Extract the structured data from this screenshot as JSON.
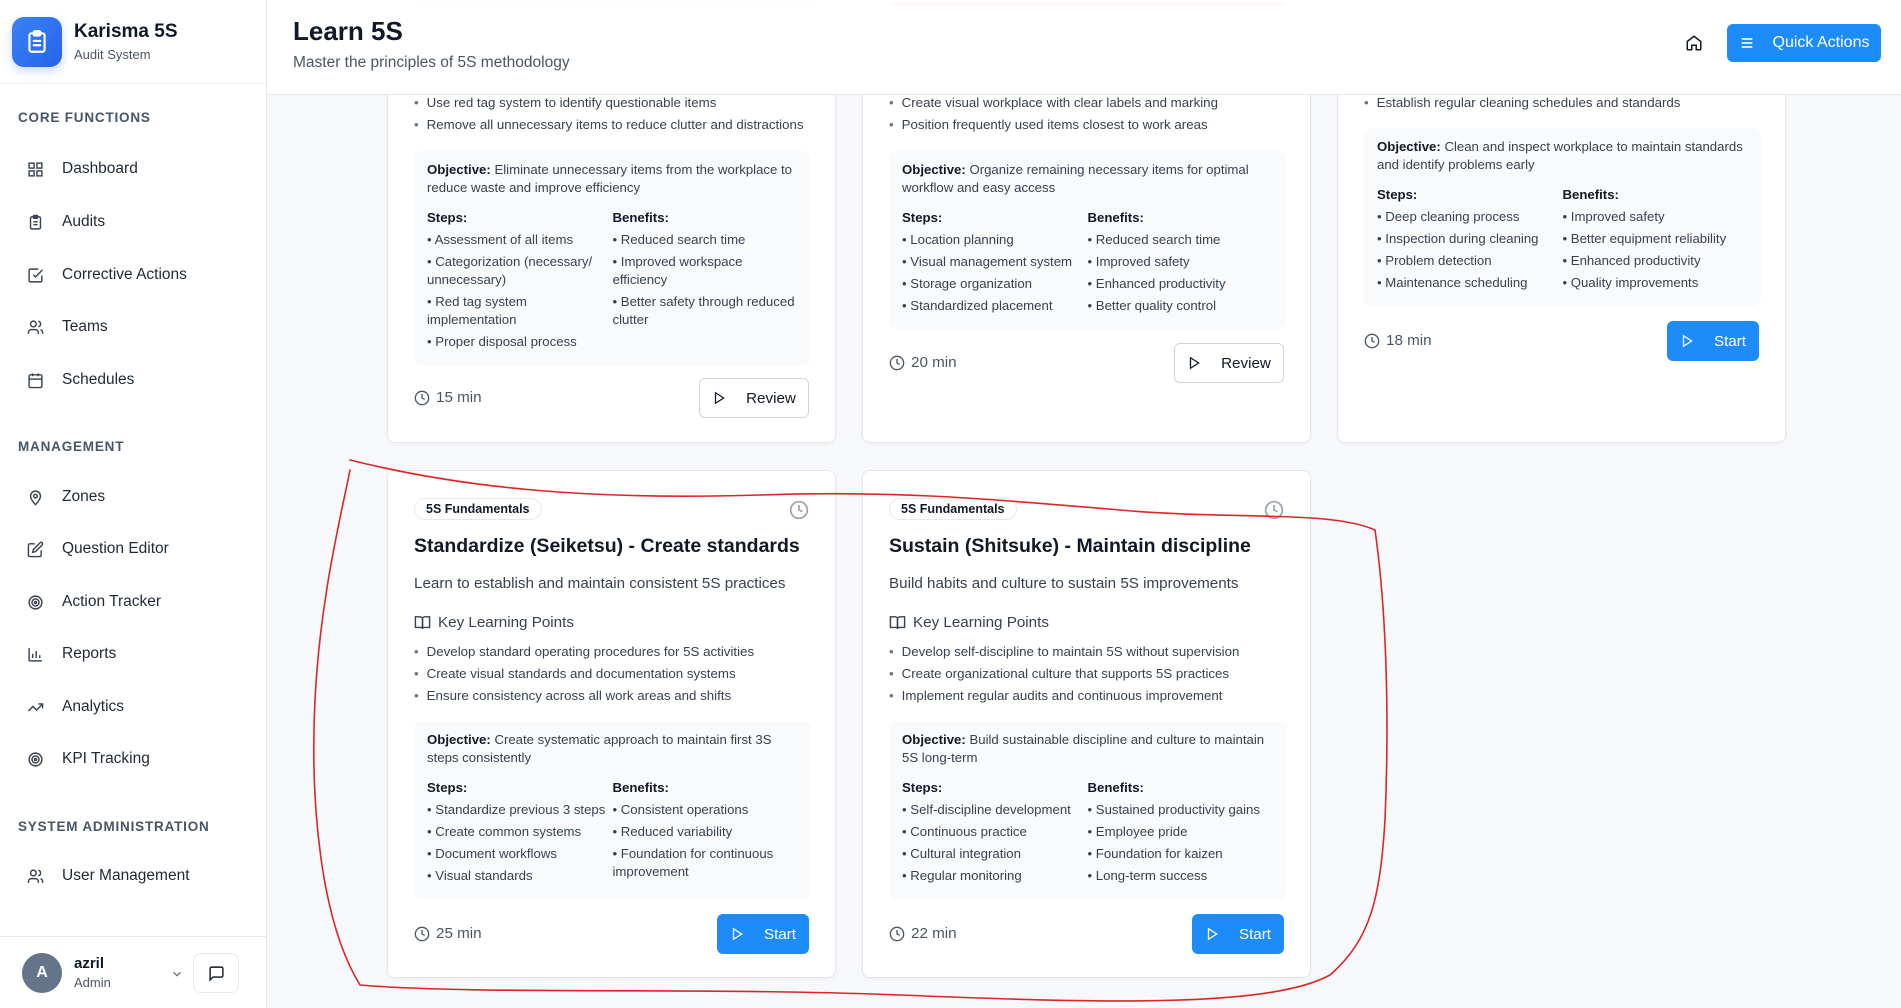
{
  "app": {
    "name": "Karisma 5S",
    "subtitle": "Audit System"
  },
  "sidebar": {
    "sections": [
      {
        "title": "CORE FUNCTIONS",
        "items": [
          {
            "label": "Dashboard",
            "icon": "grid-icon"
          },
          {
            "label": "Audits",
            "icon": "clipboard-icon"
          },
          {
            "label": "Corrective Actions",
            "icon": "check-square-icon"
          },
          {
            "label": "Teams",
            "icon": "users-icon"
          },
          {
            "label": "Schedules",
            "icon": "calendar-icon"
          }
        ]
      },
      {
        "title": "MANAGEMENT",
        "items": [
          {
            "label": "Zones",
            "icon": "map-pin-icon"
          },
          {
            "label": "Question Editor",
            "icon": "edit-icon"
          },
          {
            "label": "Action Tracker",
            "icon": "target-icon"
          },
          {
            "label": "Reports",
            "icon": "bar-chart-icon"
          },
          {
            "label": "Analytics",
            "icon": "trending-up-icon"
          },
          {
            "label": "KPI Tracking",
            "icon": "target-icon"
          }
        ]
      },
      {
        "title": "SYSTEM ADMINISTRATION",
        "items": [
          {
            "label": "User Management",
            "icon": "users-icon"
          }
        ]
      }
    ]
  },
  "user": {
    "initial": "A",
    "name": "azril",
    "role": "Admin"
  },
  "header": {
    "title": "Learn 5S",
    "subtitle": "Master the principles of 5S methodology",
    "quick_actions": "Quick Actions"
  },
  "cards": [
    {
      "points": [
        "Use red tag system to identify questionable items",
        "Remove all unnecessary items to reduce clutter and distractions"
      ],
      "objective_label": "Objective:",
      "objective": "Eliminate unnecessary items from the workplace to reduce waste and improve efficiency",
      "steps_label": "Steps:",
      "steps": [
        "Assessment of all items",
        "Categorization (necessary/ unnecessary)",
        "Red tag system implementation",
        "Proper disposal process"
      ],
      "benefits_label": "Benefits:",
      "benefits": [
        "Reduced search time",
        "Improved workspace efficiency",
        "Better safety through reduced clutter"
      ],
      "duration": "15 min",
      "action": "Review"
    },
    {
      "points": [
        "Create visual workplace with clear labels and marking",
        "Position frequently used items closest to work areas"
      ],
      "objective_label": "Objective:",
      "objective": "Organize remaining necessary items for optimal workflow and easy access",
      "steps_label": "Steps:",
      "steps": [
        "Location planning",
        "Visual management system",
        "Storage organization",
        "Standardized placement"
      ],
      "benefits_label": "Benefits:",
      "benefits": [
        "Reduced search time",
        "Improved safety",
        "Enhanced productivity",
        "Better quality control"
      ],
      "duration": "20 min",
      "action": "Review"
    },
    {
      "points": [
        "Establish regular cleaning schedules and standards"
      ],
      "objective_label": "Objective:",
      "objective": "Clean and inspect workplace to maintain standards and identify problems early",
      "steps_label": "Steps:",
      "steps": [
        "Deep cleaning process",
        "Inspection during cleaning",
        "Problem detection",
        "Maintenance scheduling"
      ],
      "benefits_label": "Benefits:",
      "benefits": [
        "Improved safety",
        "Better equipment reliability",
        "Enhanced productivity",
        "Quality improvements"
      ],
      "duration": "18 min",
      "action": "Start"
    },
    {
      "badge": "5S Fundamentals",
      "title": "Standardize (Seiketsu) - Create standards",
      "description": "Learn to establish and maintain consistent 5S practices",
      "klp": "Key Learning Points",
      "points": [
        "Develop standard operating procedures for 5S activities",
        "Create visual standards and documentation systems",
        "Ensure consistency across all work areas and shifts"
      ],
      "objective_label": "Objective:",
      "objective": "Create systematic approach to maintain first 3S steps consistently",
      "steps_label": "Steps:",
      "steps": [
        "Standardize previous 3 steps",
        "Create common systems",
        "Document workflows",
        "Visual standards"
      ],
      "benefits_label": "Benefits:",
      "benefits": [
        "Consistent operations",
        "Reduced variability",
        "Foundation for continuous improvement"
      ],
      "duration": "25 min",
      "action": "Start"
    },
    {
      "badge": "5S Fundamentals",
      "title": "Sustain (Shitsuke) - Maintain discipline",
      "description": "Build habits and culture to sustain 5S improvements",
      "klp": "Key Learning Points",
      "points": [
        "Develop self-discipline to maintain 5S without supervision",
        "Create organizational culture that supports 5S practices",
        "Implement regular audits and continuous improvement"
      ],
      "objective_label": "Objective:",
      "objective": "Build sustainable discipline and culture to maintain 5S long-term",
      "steps_label": "Steps:",
      "steps": [
        "Self-discipline development",
        "Continuous practice",
        "Cultural integration",
        "Regular monitoring"
      ],
      "benefits_label": "Benefits:",
      "benefits": [
        "Sustained productivity gains",
        "Employee pride",
        "Foundation for kaizen",
        "Long-term success"
      ],
      "duration": "22 min",
      "action": "Start"
    }
  ],
  "colors": {
    "primary": "#1d8cf8",
    "annotation": "#dc2626"
  }
}
